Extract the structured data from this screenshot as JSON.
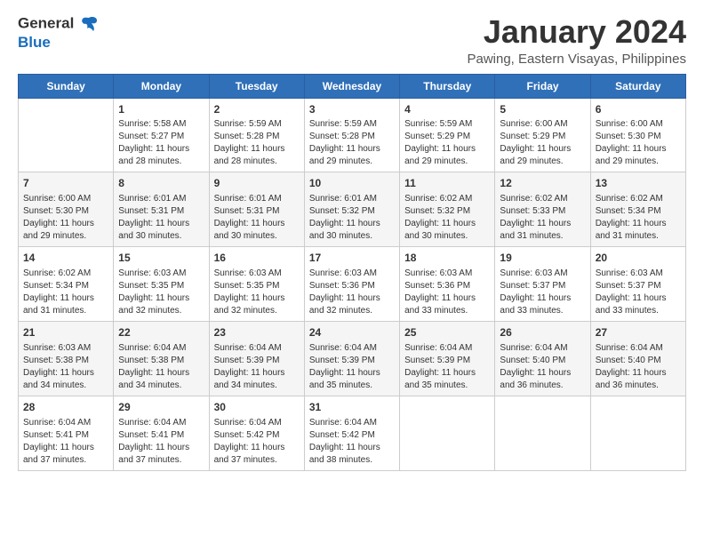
{
  "header": {
    "logo_line1": "General",
    "logo_line2": "Blue",
    "title": "January 2024",
    "subtitle": "Pawing, Eastern Visayas, Philippines"
  },
  "calendar": {
    "days_of_week": [
      "Sunday",
      "Monday",
      "Tuesday",
      "Wednesday",
      "Thursday",
      "Friday",
      "Saturday"
    ],
    "weeks": [
      [
        {
          "day": "",
          "info": ""
        },
        {
          "day": "1",
          "info": "Sunrise: 5:58 AM\nSunset: 5:27 PM\nDaylight: 11 hours\nand 28 minutes."
        },
        {
          "day": "2",
          "info": "Sunrise: 5:59 AM\nSunset: 5:28 PM\nDaylight: 11 hours\nand 28 minutes."
        },
        {
          "day": "3",
          "info": "Sunrise: 5:59 AM\nSunset: 5:28 PM\nDaylight: 11 hours\nand 29 minutes."
        },
        {
          "day": "4",
          "info": "Sunrise: 5:59 AM\nSunset: 5:29 PM\nDaylight: 11 hours\nand 29 minutes."
        },
        {
          "day": "5",
          "info": "Sunrise: 6:00 AM\nSunset: 5:29 PM\nDaylight: 11 hours\nand 29 minutes."
        },
        {
          "day": "6",
          "info": "Sunrise: 6:00 AM\nSunset: 5:30 PM\nDaylight: 11 hours\nand 29 minutes."
        }
      ],
      [
        {
          "day": "7",
          "info": "Sunrise: 6:00 AM\nSunset: 5:30 PM\nDaylight: 11 hours\nand 29 minutes."
        },
        {
          "day": "8",
          "info": "Sunrise: 6:01 AM\nSunset: 5:31 PM\nDaylight: 11 hours\nand 30 minutes."
        },
        {
          "day": "9",
          "info": "Sunrise: 6:01 AM\nSunset: 5:31 PM\nDaylight: 11 hours\nand 30 minutes."
        },
        {
          "day": "10",
          "info": "Sunrise: 6:01 AM\nSunset: 5:32 PM\nDaylight: 11 hours\nand 30 minutes."
        },
        {
          "day": "11",
          "info": "Sunrise: 6:02 AM\nSunset: 5:32 PM\nDaylight: 11 hours\nand 30 minutes."
        },
        {
          "day": "12",
          "info": "Sunrise: 6:02 AM\nSunset: 5:33 PM\nDaylight: 11 hours\nand 31 minutes."
        },
        {
          "day": "13",
          "info": "Sunrise: 6:02 AM\nSunset: 5:34 PM\nDaylight: 11 hours\nand 31 minutes."
        }
      ],
      [
        {
          "day": "14",
          "info": "Sunrise: 6:02 AM\nSunset: 5:34 PM\nDaylight: 11 hours\nand 31 minutes."
        },
        {
          "day": "15",
          "info": "Sunrise: 6:03 AM\nSunset: 5:35 PM\nDaylight: 11 hours\nand 32 minutes."
        },
        {
          "day": "16",
          "info": "Sunrise: 6:03 AM\nSunset: 5:35 PM\nDaylight: 11 hours\nand 32 minutes."
        },
        {
          "day": "17",
          "info": "Sunrise: 6:03 AM\nSunset: 5:36 PM\nDaylight: 11 hours\nand 32 minutes."
        },
        {
          "day": "18",
          "info": "Sunrise: 6:03 AM\nSunset: 5:36 PM\nDaylight: 11 hours\nand 33 minutes."
        },
        {
          "day": "19",
          "info": "Sunrise: 6:03 AM\nSunset: 5:37 PM\nDaylight: 11 hours\nand 33 minutes."
        },
        {
          "day": "20",
          "info": "Sunrise: 6:03 AM\nSunset: 5:37 PM\nDaylight: 11 hours\nand 33 minutes."
        }
      ],
      [
        {
          "day": "21",
          "info": "Sunrise: 6:03 AM\nSunset: 5:38 PM\nDaylight: 11 hours\nand 34 minutes."
        },
        {
          "day": "22",
          "info": "Sunrise: 6:04 AM\nSunset: 5:38 PM\nDaylight: 11 hours\nand 34 minutes."
        },
        {
          "day": "23",
          "info": "Sunrise: 6:04 AM\nSunset: 5:39 PM\nDaylight: 11 hours\nand 34 minutes."
        },
        {
          "day": "24",
          "info": "Sunrise: 6:04 AM\nSunset: 5:39 PM\nDaylight: 11 hours\nand 35 minutes."
        },
        {
          "day": "25",
          "info": "Sunrise: 6:04 AM\nSunset: 5:39 PM\nDaylight: 11 hours\nand 35 minutes."
        },
        {
          "day": "26",
          "info": "Sunrise: 6:04 AM\nSunset: 5:40 PM\nDaylight: 11 hours\nand 36 minutes."
        },
        {
          "day": "27",
          "info": "Sunrise: 6:04 AM\nSunset: 5:40 PM\nDaylight: 11 hours\nand 36 minutes."
        }
      ],
      [
        {
          "day": "28",
          "info": "Sunrise: 6:04 AM\nSunset: 5:41 PM\nDaylight: 11 hours\nand 37 minutes."
        },
        {
          "day": "29",
          "info": "Sunrise: 6:04 AM\nSunset: 5:41 PM\nDaylight: 11 hours\nand 37 minutes."
        },
        {
          "day": "30",
          "info": "Sunrise: 6:04 AM\nSunset: 5:42 PM\nDaylight: 11 hours\nand 37 minutes."
        },
        {
          "day": "31",
          "info": "Sunrise: 6:04 AM\nSunset: 5:42 PM\nDaylight: 11 hours\nand 38 minutes."
        },
        {
          "day": "",
          "info": ""
        },
        {
          "day": "",
          "info": ""
        },
        {
          "day": "",
          "info": ""
        }
      ]
    ]
  }
}
